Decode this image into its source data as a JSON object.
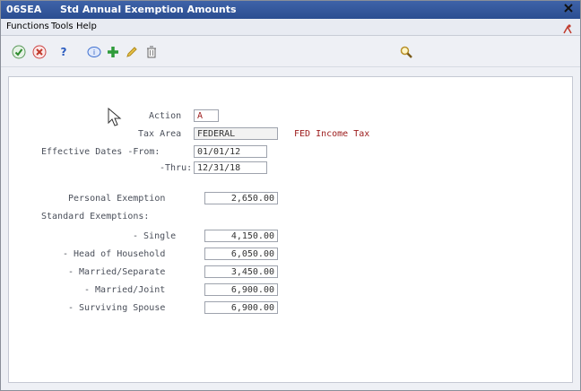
{
  "window": {
    "code": "06SEA",
    "title": "Std Annual Exemption Amounts"
  },
  "menu": [
    "Functions",
    "Tools",
    "Help"
  ],
  "toolbar": {
    "icons": [
      "checkmark-icon",
      "cancel-icon",
      "help-icon",
      "info-icon",
      "add-icon",
      "edit-pencil-icon",
      "delete-trash-icon",
      "search-icon"
    ],
    "help_glyph": "?"
  },
  "form": {
    "action": {
      "label": "Action",
      "value": "A"
    },
    "tax_area": {
      "label": "Tax Area",
      "value": "FEDERAL",
      "description": "FED Income Tax"
    },
    "effective_dates_label": "Effective Dates -From:",
    "from": {
      "value": "01/01/12"
    },
    "thru": {
      "label": "-Thru:",
      "value": "12/31/18"
    },
    "personal_exemption": {
      "label": "Personal Exemption",
      "value": "2,650.00"
    },
    "standard_exemptions_label": "Standard Exemptions:",
    "single": {
      "label": "- Single",
      "value": "4,150.00"
    },
    "head_of_household": {
      "label": "- Head of Household",
      "value": "6,050.00"
    },
    "married_separate": {
      "label": "- Married/Separate",
      "value": "3,450.00"
    },
    "married_joint": {
      "label": "- Married/Joint",
      "value": "6,900.00"
    },
    "surviving_spouse": {
      "label": "- Surviving Spouse",
      "value": "6,900.00"
    }
  },
  "colors": {
    "title_bar": "#2f56a0",
    "description_text": "#9b1a1a"
  }
}
